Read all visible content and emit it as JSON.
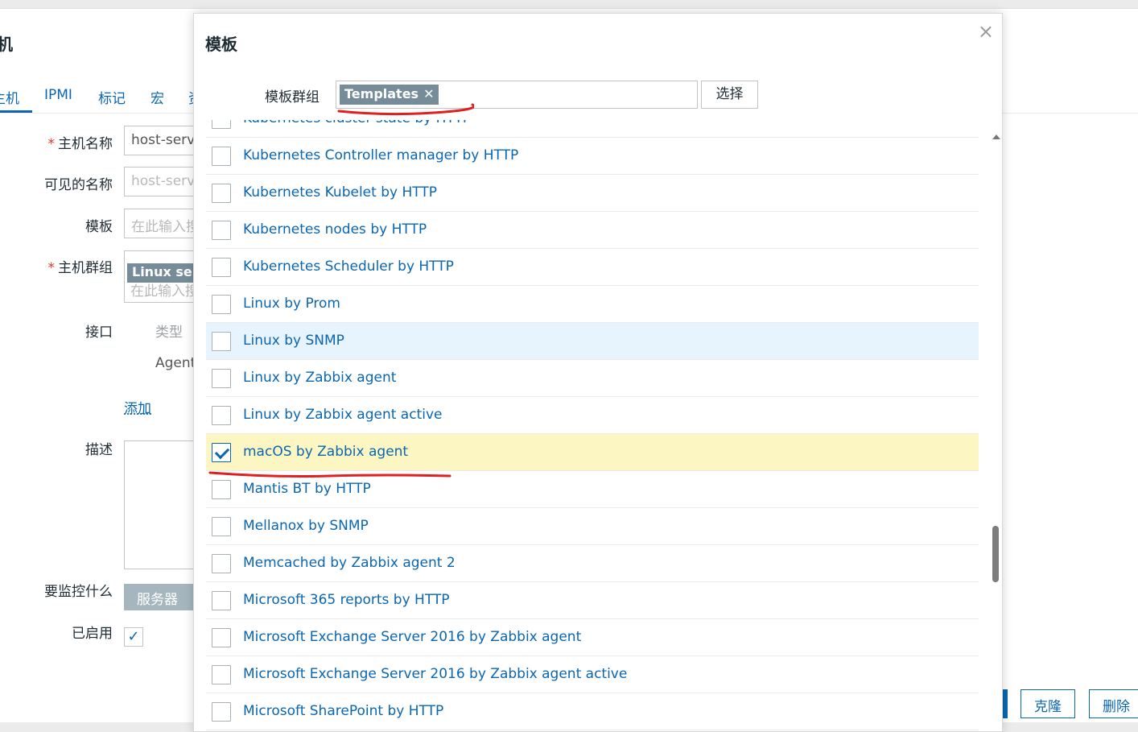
{
  "background": {
    "title": "机",
    "tabs": [
      "主机",
      "IPMI",
      "标记",
      "宏",
      "资"
    ],
    "labels": {
      "host_name": "主机名称",
      "visible_name": "可见的名称",
      "templates": "模板",
      "host_groups": "主机群组",
      "interfaces": "接口",
      "description": "描述",
      "monitor_what": "要监控什么",
      "enabled": "已启用"
    },
    "host_name_value": "host-server",
    "visible_name_value": "host-server",
    "templates_placeholder": "在此输入搜索",
    "host_group_chip": "Linux servers",
    "host_group_placeholder": "在此输入搜索",
    "interface_type_header": "类型",
    "interface_type": "Agent",
    "add_link": "添加",
    "server_button": "服务器",
    "enabled_check": "✓",
    "clone_button": "克隆",
    "delete_button": "删除"
  },
  "modal": {
    "title": "模板",
    "close_icon": "×",
    "filter": {
      "label": "模板群组",
      "chip": "Templates",
      "chip_remove": "✕",
      "select_button": "选择"
    },
    "items": [
      {
        "label": "Kubernetes cluster state by HTTP",
        "checked": false
      },
      {
        "label": "Kubernetes Controller manager by HTTP",
        "checked": false
      },
      {
        "label": "Kubernetes Kubelet by HTTP",
        "checked": false
      },
      {
        "label": "Kubernetes nodes by HTTP",
        "checked": false
      },
      {
        "label": "Kubernetes Scheduler by HTTP",
        "checked": false
      },
      {
        "label": "Linux by Prom",
        "checked": false
      },
      {
        "label": "Linux by SNMP",
        "checked": false,
        "state": "hover"
      },
      {
        "label": "Linux by Zabbix agent",
        "checked": false
      },
      {
        "label": "Linux by Zabbix agent active",
        "checked": false
      },
      {
        "label": "macOS by Zabbix agent",
        "checked": true,
        "state": "selected"
      },
      {
        "label": "Mantis BT by HTTP",
        "checked": false
      },
      {
        "label": "Mellanox by SNMP",
        "checked": false
      },
      {
        "label": "Memcached by Zabbix agent 2",
        "checked": false
      },
      {
        "label": "Microsoft 365 reports by HTTP",
        "checked": false
      },
      {
        "label": "Microsoft Exchange Server 2016 by Zabbix agent",
        "checked": false
      },
      {
        "label": "Microsoft Exchange Server 2016 by Zabbix agent active",
        "checked": false
      },
      {
        "label": "Microsoft SharePoint by HTTP",
        "checked": false
      }
    ]
  },
  "colors": {
    "link": "#0a66b0",
    "selected_row": "#fcf7c2",
    "hover_row": "#e8f4fd",
    "chip": "#768d99",
    "annotation": "#e02020"
  }
}
